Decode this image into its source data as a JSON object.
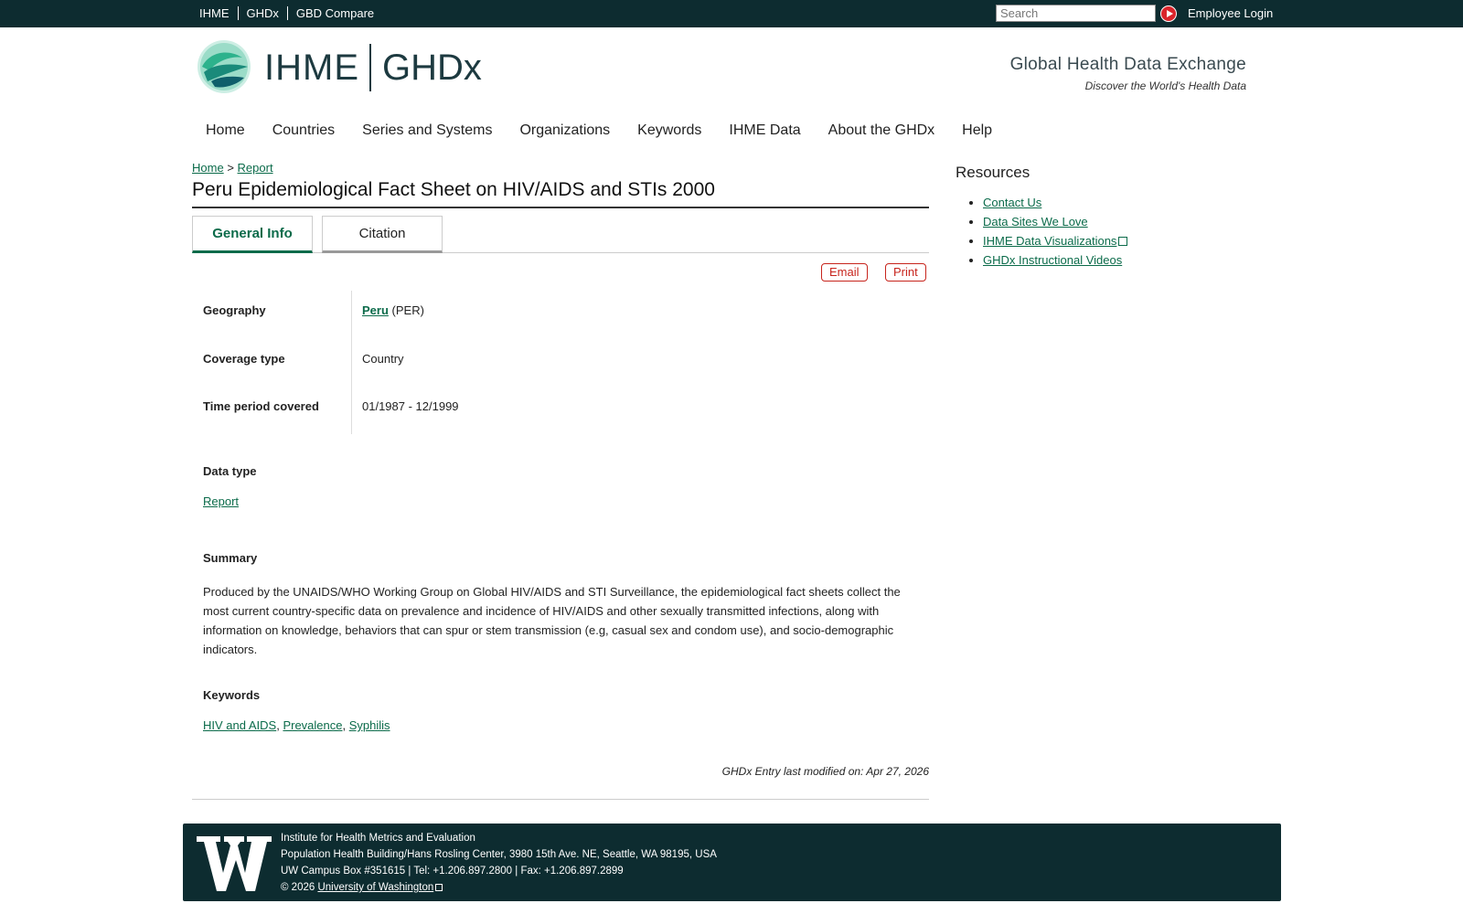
{
  "topbar": {
    "links": [
      "IHME",
      "GHDx",
      "GBD Compare"
    ],
    "search_placeholder": "Search",
    "login_label": "Employee Login"
  },
  "header": {
    "logo_ihme": "IHME",
    "logo_ghdx": "GHDx",
    "tagline_title": "Global Health Data Exchange",
    "tagline_sub": "Discover the World's Health Data"
  },
  "nav": [
    "Home",
    "Countries",
    "Series and Systems",
    "Organizations",
    "Keywords",
    "IHME Data",
    "About the GHDx",
    "Help"
  ],
  "breadcrumb": {
    "home": "Home",
    "sep": ">",
    "current": "Report"
  },
  "page_title": "Peru Epidemiological Fact Sheet on HIV/AIDS and STIs 2000",
  "tabs": [
    "General Info",
    "Citation"
  ],
  "actions": {
    "email": "Email",
    "print": "Print"
  },
  "fields": {
    "geography_label": "Geography",
    "geography_link": "Peru",
    "geography_code": "(PER)",
    "coverage_label": "Coverage type",
    "coverage_value": "Country",
    "time_label": "Time period covered",
    "time_value": "01/1987 - 12/1999"
  },
  "data_type": {
    "label": "Data type",
    "value": "Report"
  },
  "summary": {
    "label": "Summary",
    "text": "Produced by the UNAIDS/WHO Working Group on Global HIV/AIDS and STI Surveillance, the epidemiological fact sheets collect the most current country-specific data on prevalence and incidence of HIV/AIDS and other sexually transmitted infections, along with information on knowledge, behaviors that can spur or stem transmission (e.g, casual sex and condom use), and socio-demographic indicators."
  },
  "keywords": {
    "label": "Keywords",
    "items": [
      "HIV and AIDS",
      "Prevalence",
      "Syphilis"
    ]
  },
  "modified": "GHDx Entry last modified on: Apr 27, 2026",
  "resources": {
    "title": "Resources",
    "items": [
      "Contact Us",
      "Data Sites We Love",
      "IHME Data Visualizations",
      "GHDx Instructional Videos"
    ]
  },
  "footer": {
    "line1": "Institute for Health Metrics and Evaluation",
    "line2": "Population Health Building/Hans Rosling Center, 3980 15th Ave. NE, Seattle, WA 98195, USA",
    "line3": "UW Campus Box #351615 | Tel: +1.206.897.2800 | Fax: +1.206.897.2899",
    "copyright": "© 2026",
    "uw_link": "University of Washington"
  }
}
